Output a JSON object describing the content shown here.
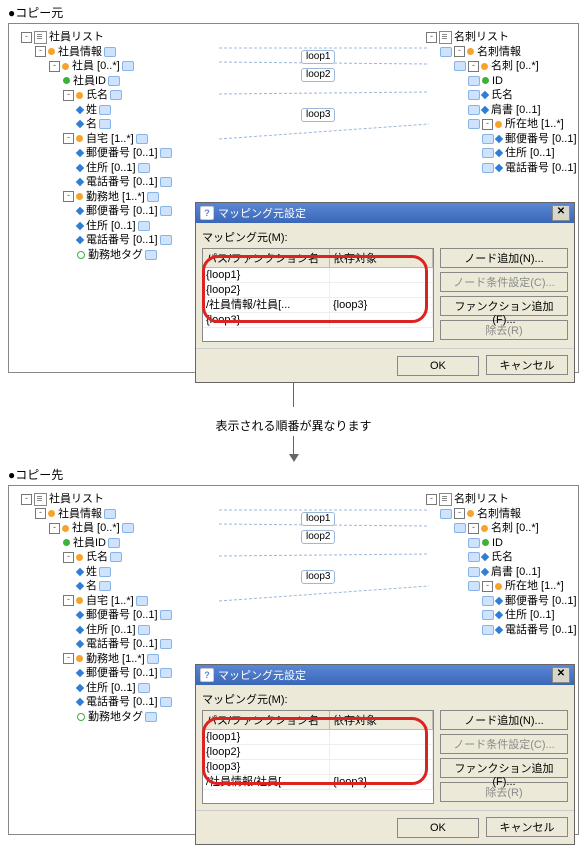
{
  "labels": {
    "copy_src": "コピー元",
    "copy_dst": "コピー先"
  },
  "leftTree": {
    "root": "社員リスト",
    "l1": "社員情報",
    "l2": "社員 [0..*]",
    "id": "社員ID",
    "name": "氏名",
    "lastname": "姓",
    "firstname": "名",
    "home": "自宅 [1..*]",
    "postal": "郵便番号 [0..1]",
    "address": "住所 [0..1]",
    "tel": "電話番号 [0..1]",
    "work": "勤務地 [1..*]",
    "wpostal": "郵便番号 [0..1]",
    "waddress": "住所 [0..1]",
    "wtel": "電話番号 [0..1]",
    "wtag": "勤務地タグ"
  },
  "rightTree": {
    "root": "名刺リスト",
    "l1": "名刺情報",
    "l2": "名刺 [0..*]",
    "id": "ID",
    "name": "氏名",
    "dept": "肩書 [0..1]",
    "loc": "所在地 [1..*]",
    "postal": "郵便番号 [0..1]",
    "address": "住所 [0..1]",
    "tel": "電話番号 [0..1]"
  },
  "loops": {
    "l1": "loop1",
    "l2": "loop2",
    "l3": "loop3"
  },
  "dialog": {
    "title": "マッピング元設定",
    "label": "マッピング元(M):",
    "col1": "パス/ファンクション名",
    "col2": "依存対象",
    "btn_add_node": "ノード追加(N)...",
    "btn_node_cond": "ノード条件設定(C)...",
    "btn_add_func": "ファンクション追加(F)...",
    "btn_remove": "除去(R)",
    "btn_ok": "OK",
    "btn_cancel": "キャンセル"
  },
  "gridSrc": [
    {
      "path": "{loop1}",
      "dep": ""
    },
    {
      "path": "{loop2}",
      "dep": ""
    },
    {
      "path": "/社員情報/社員[...",
      "dep": "{loop3}"
    },
    {
      "path": "{loop3}",
      "dep": ""
    }
  ],
  "gridDst": [
    {
      "path": "{loop1}",
      "dep": ""
    },
    {
      "path": "{loop2}",
      "dep": ""
    },
    {
      "path": "{loop3}",
      "dep": ""
    },
    {
      "path": "/社員情報/社員[...",
      "dep": "{loop3}"
    }
  ],
  "note": "表示される順番が異なります"
}
